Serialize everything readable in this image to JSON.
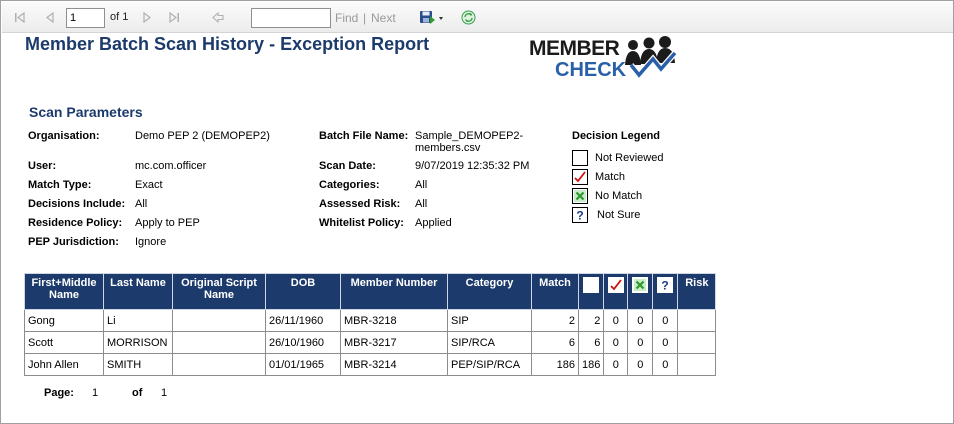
{
  "toolbar": {
    "page_value": "1",
    "of_label": "of 1",
    "find_label": "Find",
    "separator": "|",
    "next_label": "Next"
  },
  "report": {
    "title": "Member Batch Scan History - Exception Report",
    "logo_line1": "MEMBER",
    "logo_line2": "CHECK",
    "section_title": "Scan Parameters"
  },
  "params_left": [
    {
      "label": "Organisation:",
      "value": "Demo PEP 2 (DEMOPEP2)"
    },
    {
      "label": "User:",
      "value": "mc.com.officer"
    },
    {
      "label": "Match Type:",
      "value": "Exact"
    },
    {
      "label": "Decisions Include:",
      "value": "All"
    },
    {
      "label": "Residence Policy:",
      "value": "Apply to PEP"
    },
    {
      "label": "PEP Jurisdiction:",
      "value": "Ignore"
    }
  ],
  "params_right": [
    {
      "label": "Batch File Name:",
      "value": "Sample_DEMOPEP2-",
      "value2": "members.csv"
    },
    {
      "label": "Scan Date:",
      "value": "9/07/2019 12:35:32 PM"
    },
    {
      "label": "Categories:",
      "value": "All"
    },
    {
      "label": "Assessed Risk:",
      "value": "All"
    },
    {
      "label": "Whitelist Policy:",
      "value": "Applied"
    }
  ],
  "legend": {
    "title": "Decision Legend",
    "items": [
      "Not Reviewed",
      "Match",
      "No Match",
      "Not Sure"
    ]
  },
  "table": {
    "headers": [
      "First+Middle Name",
      "Last Name",
      "Original Script Name",
      "DOB",
      "Member Number",
      "Category",
      "Match",
      "",
      "",
      "",
      "",
      "Risk"
    ],
    "rows": [
      [
        "Gong",
        "Li",
        "",
        "26/11/1960",
        "MBR-3218",
        "SIP",
        "2",
        "2",
        "0",
        "0",
        "0",
        ""
      ],
      [
        "Scott",
        "MORRISON",
        "",
        "26/10/1960",
        "MBR-3217",
        "SIP/RCA",
        "6",
        "6",
        "0",
        "0",
        "0",
        ""
      ],
      [
        "John Allen",
        "SMITH",
        "",
        "01/01/1965",
        "MBR-3214",
        "PEP/SIP/RCA",
        "186",
        "186",
        "0",
        "0",
        "0",
        ""
      ]
    ]
  },
  "pager": {
    "page_label": "Page:",
    "page_value": "1",
    "of_label": "of",
    "of_value": "1"
  },
  "colors": {
    "header_navy": "#1c3a6b",
    "logo_blue": "#2a5faa",
    "match_red": "#cc1111",
    "nomatch_green": "#2e9a2e"
  }
}
